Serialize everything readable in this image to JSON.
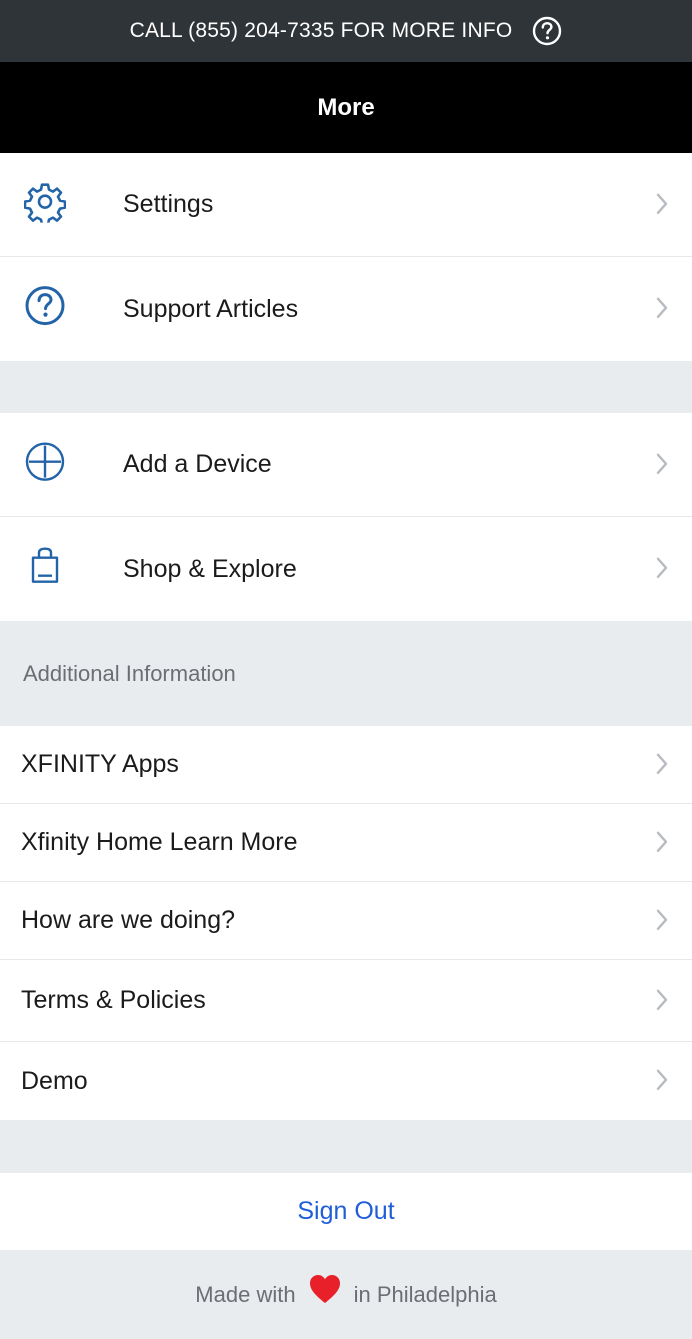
{
  "banner": {
    "text": "CALL (855) 204-7335 FOR MORE INFO",
    "help_icon": "question-circle-icon"
  },
  "header": {
    "title": "More"
  },
  "group1": [
    {
      "label": "Settings",
      "icon": "gear-icon"
    },
    {
      "label": "Support Articles",
      "icon": "question-circle-icon"
    }
  ],
  "group2": [
    {
      "label": "Add a Device",
      "icon": "plus-circle-icon"
    },
    {
      "label": "Shop & Explore",
      "icon": "shopping-bag-icon"
    }
  ],
  "additional": {
    "header": "Additional Information",
    "items": [
      {
        "label": "XFINITY Apps"
      },
      {
        "label": "Xfinity Home Learn More"
      },
      {
        "label": "How are we doing?"
      },
      {
        "label": "Terms & Policies"
      },
      {
        "label": "Demo"
      }
    ]
  },
  "signout": {
    "label": "Sign Out"
  },
  "footer": {
    "prefix": "Made with",
    "suffix": "in Philadelphia"
  },
  "colors": {
    "accent": "#1f5ed8",
    "icon_blue": "#2364a8",
    "heart": "#e8202a",
    "banner_bg": "#2f3438",
    "header_bg": "#000000"
  }
}
